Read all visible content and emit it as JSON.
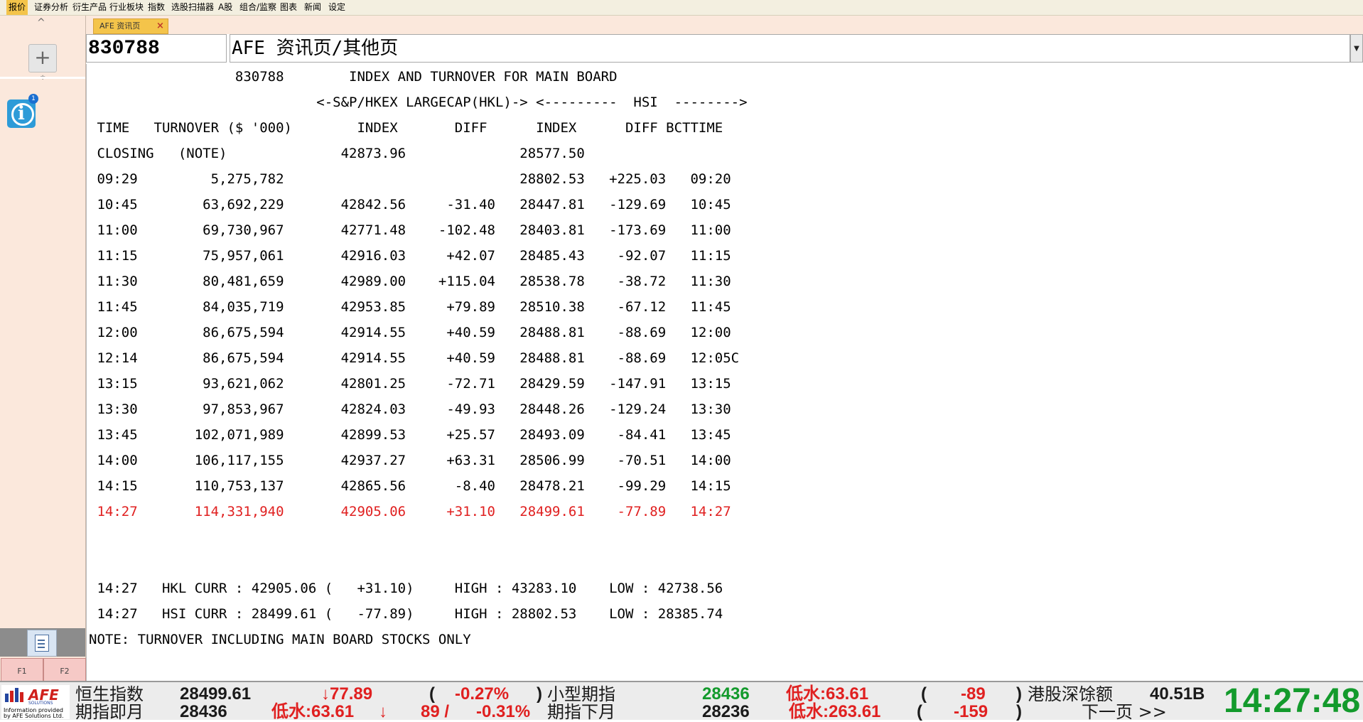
{
  "menu": {
    "items": [
      "报价",
      "证券分析",
      "衍生产品",
      "行业板块",
      "指数",
      "选股扫描器",
      "A股",
      "组合/监察",
      "图表",
      "新闻",
      "设定"
    ],
    "active": "报价"
  },
  "sidebar": {
    "collapse_glyph": "^",
    "add_glyph": "+",
    "resize_glyph": "≑",
    "info_badge": "1",
    "info_glyph": "i",
    "fkeys": [
      "F1",
      "F2"
    ]
  },
  "tab": {
    "label": "AFE 资讯页",
    "close_glyph": "×"
  },
  "page": {
    "code": "830788",
    "title": "AFE 资讯页/其他页",
    "dropdown_glyph": "▼"
  },
  "report": {
    "lines": [
      "                  830788        INDEX AND TURNOVER FOR MAIN BOARD",
      "                            <-S&P/HKEX LARGECAP(HKL)-> <---------  HSI  -------->",
      " TIME   TURNOVER ($ '000)        INDEX       DIFF      INDEX      DIFF BCTTIME",
      " CLOSING   (NOTE)              42873.96              28577.50",
      " 09:29         5,275,782                             28802.53   +225.03   09:20",
      " 10:45        63,692,229       42842.56     -31.40   28447.81   -129.69   10:45",
      " 11:00        69,730,967       42771.48    -102.48   28403.81   -173.69   11:00",
      " 11:15        75,957,061       42916.03     +42.07   28485.43    -92.07   11:15",
      " 11:30        80,481,659       42989.00    +115.04   28538.78    -38.72   11:30",
      " 11:45        84,035,719       42953.85     +79.89   28510.38    -67.12   11:45",
      " 12:00        86,675,594       42914.55     +40.59   28488.81    -88.69   12:00",
      " 12:14        86,675,594       42914.55     +40.59   28488.81    -88.69   12:05C",
      " 13:15        93,621,062       42801.25     -72.71   28429.59   -147.91   13:15",
      " 13:30        97,853,967       42824.03     -49.93   28448.26   -129.24   13:30",
      " 13:45       102,071,989       42899.53     +25.57   28493.09    -84.41   13:45",
      " 14:00       106,117,155       42937.27     +63.31   28506.99    -70.51   14:00",
      " 14:15       110,753,137       42865.56      -8.40   28478.21    -99.29   14:15",
      " 14:27       114,331,940       42905.06     +31.10   28499.61    -77.89   14:27",
      "",
      "",
      " 14:27   HKL CURR : 42905.06 (   +31.10)     HIGH : 43283.10    LOW : 42738.56",
      " 14:27   HSI CURR : 28499.61 (   -77.89)     HIGH : 28802.53    LOW : 28385.74",
      "NOTE: TURNOVER INCLUDING MAIN BOARD STOCKS ONLY"
    ],
    "highlight_line": 17,
    "highlight_color": "#e02020"
  },
  "ticker": {
    "logo": {
      "name": "AFE",
      "sub": "SOLUTIONS",
      "footer": "Information provided by AFE Solutions Ltd."
    },
    "row1": {
      "hsi_label": "恒生指数",
      "hsi_value": "28499.61",
      "hsi_change": "↓77.89",
      "hsi_pct_open": "(",
      "hsi_pct": "-0.27%",
      "hsi_pct_close": ")",
      "mini_label": "小型期指",
      "mini_value": "28436",
      "mini_basis": "低水:63.61",
      "mini_chg_open": "(",
      "mini_chg": "-89",
      "mini_chg_close": ")",
      "connect_label": "港股深馀额",
      "connect_value": "40.51B"
    },
    "row2": {
      "fut_label": "期指即月",
      "fut_value": "28436",
      "fut_basis": "低水:63.61",
      "fut_arrow": "↓",
      "fut_chg": "89 /",
      "fut_pct": "-0.31%",
      "next_label": "期指下月",
      "next_value": "28236",
      "next_basis": "低水:263.61",
      "next_chg_open": "(",
      "next_chg": "-159",
      "next_chg_close": ")",
      "nav_label": "下一页 >>"
    },
    "clock": "14:27:48",
    "colors": {
      "up": "#139a2c",
      "down": "#e02020"
    }
  }
}
